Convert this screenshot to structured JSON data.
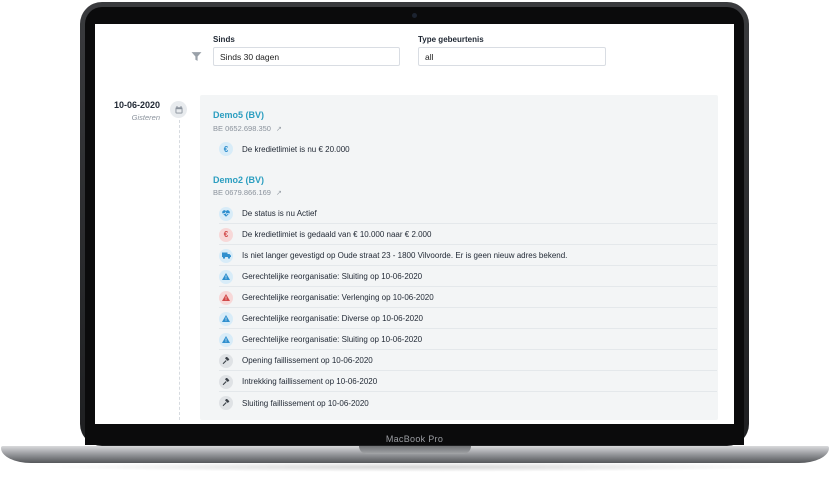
{
  "device": {
    "model_label": "MacBook Pro"
  },
  "filters": {
    "since_label": "Sinds",
    "since_value": "Sinds 30 dagen",
    "type_label": "Type gebeurtenis",
    "type_value": "all"
  },
  "timeline": {
    "date": "10-06-2020",
    "relative": "Gisteren",
    "companies": [
      {
        "name": "Demo5 (BV)",
        "vat": "BE 0652.698.350",
        "events": [
          {
            "icon": "euro-icon",
            "color": "#2f8fce",
            "text": "De kredietlimiet is nu € 20.000"
          }
        ]
      },
      {
        "name": "Demo2 (BV)",
        "vat": "BE 0679.866.169",
        "events": [
          {
            "icon": "heart-pulse-icon",
            "color": "#2f8fce",
            "text": "De status is nu Actief"
          },
          {
            "icon": "euro-icon",
            "color": "#d14949",
            "text": "De kredietlimiet is gedaald van € 10.000 naar € 2.000"
          },
          {
            "icon": "truck-icon",
            "color": "#2f8fce",
            "text": "Is niet langer gevestigd op Oude straat 23 - 1800 Vilvoorde. Er is geen nieuw adres bekend."
          },
          {
            "icon": "warning-icon",
            "color": "#2f8fce",
            "text": "Gerechtelijke reorganisatie: Sluiting op 10-06-2020"
          },
          {
            "icon": "warning-icon",
            "color": "#d14949",
            "text": "Gerechtelijke reorganisatie: Verlenging op 10-06-2020"
          },
          {
            "icon": "warning-icon",
            "color": "#2f8fce",
            "text": "Gerechtelijke reorganisatie: Diverse op 10-06-2020"
          },
          {
            "icon": "warning-icon",
            "color": "#2f8fce",
            "text": "Gerechtelijke reorganisatie: Sluiting op 10-06-2020"
          },
          {
            "icon": "gavel-icon",
            "color": "#3b4148",
            "text": "Opening faillissement op 10-06-2020"
          },
          {
            "icon": "gavel-icon",
            "color": "#3b4148",
            "text": "Intrekking faillissement op 10-06-2020"
          },
          {
            "icon": "gavel-icon",
            "color": "#3b4148",
            "text": "Sluiting faillissement op 10-06-2020"
          }
        ]
      }
    ]
  }
}
